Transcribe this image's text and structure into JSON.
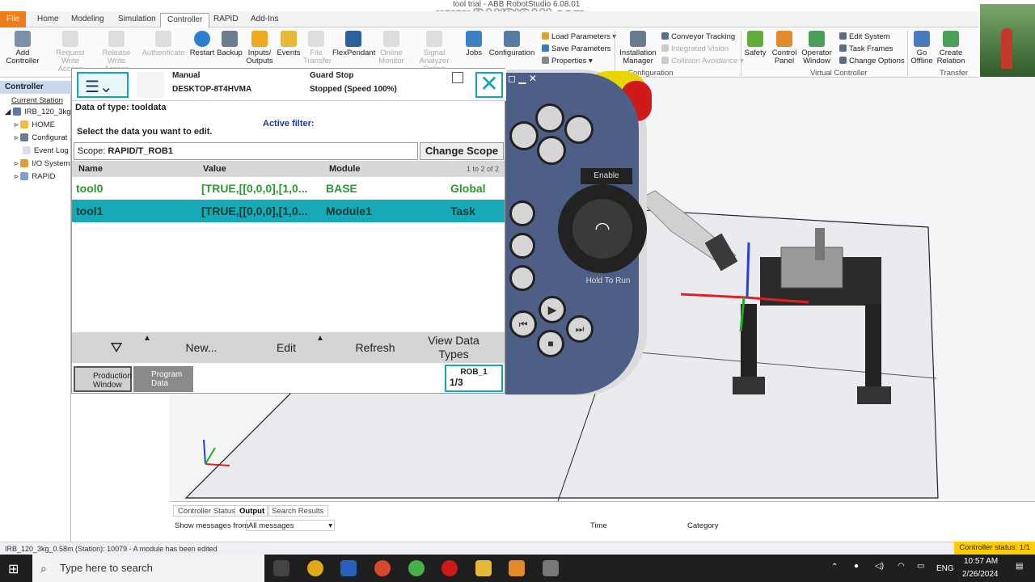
{
  "window": {
    "title": "tool trial - ABB RobotStudio 6.08.01",
    "watermark": "www.BANDICAM.com"
  },
  "tabs": [
    "File",
    "Home",
    "Modeling",
    "Simulation",
    "Controller",
    "RAPID",
    "Add-Ins"
  ],
  "ribbon": {
    "add_controller": "Add\nController",
    "request_write_access": "Request\nWrite Access",
    "release_write_access": "Release\nWrite Access",
    "authenticate": "Authenticate",
    "restart": "Restart",
    "backup": "Backup",
    "inputs_outputs": "Inputs/\nOutputs",
    "events": "Events",
    "file_transfer": "File\nTransfer",
    "flexpendant": "FlexPendant",
    "online_monitor": "Online\nMonitor",
    "signal_analyzer": "Signal Analyzer\nOnline",
    "jobs": "Jobs",
    "configuration": "Configuration",
    "load_parameters": "Load Parameters",
    "save_parameters": "Save Parameters",
    "properties": "Properties",
    "installation_manager": "Installation\nManager",
    "conveyor_tracking": "Conveyor Tracking",
    "integrated_vision": "Integrated Vision",
    "collision_avoidance": "Collision Avoidance",
    "group_configuration": "Configuration",
    "safety": "Safety",
    "control_panel": "Control\nPanel",
    "operator_window": "Operator\nWindow",
    "edit_system": "Edit System",
    "task_frames": "Task Frames",
    "change_options": "Change Options",
    "group_virtual_controller": "Virtual Controller",
    "go_offline": "Go\nOffline",
    "create_relation": "Create\nRelation",
    "group_transfer": "Transfer"
  },
  "left_panel": {
    "header": "Controller",
    "current_station": "Current Station",
    "items": [
      "IRB_120_3kg",
      "HOME",
      "Configurat",
      "Event Log",
      "I/O System",
      "RAPID"
    ]
  },
  "flexpendant": {
    "mode": "Manual",
    "system_name": "DESKTOP-8T4HVMA",
    "state": "Guard Stop",
    "speed": "Stopped (Speed 100%)",
    "data_type": "Data of type: tooldata",
    "instruction": "Select the data you want to edit.",
    "filter_label": "Active filter:",
    "scope_label": "Scope:",
    "scope_value": "RAPID/T_ROB1",
    "change_scope": "Change Scope",
    "columns": [
      "Name",
      "Value",
      "Module"
    ],
    "count": "1 to 2 of 2",
    "rows": [
      {
        "name": "tool0",
        "value": "[TRUE,[[0,0,0],[1,0...",
        "module": "BASE",
        "scope": "Global"
      },
      {
        "name": "tool1",
        "value": "[TRUE,[[0,0,0],[1,0...",
        "module": "Module1",
        "scope": "Task"
      }
    ],
    "bottom_buttons": {
      "new": "New...",
      "edit": "Edit",
      "refresh": "Refresh",
      "view": "View Data\nTypes"
    },
    "taskbar": {
      "production": "Production\nWindow",
      "program": "Program\nData",
      "rob": "ROB_1",
      "ratio": "1/3"
    }
  },
  "pendant": {
    "enable": "Enable",
    "hold_to_run": "Hold To Run"
  },
  "output": {
    "tabs": [
      "Controller Status",
      "Output",
      "Search Results"
    ],
    "show_label": "Show messages from",
    "show_value": "All messages",
    "col_time": "Time",
    "col_category": "Category"
  },
  "status": {
    "message": "IRB_120_3kg_0.58m (Station): 10079 - A module has been edited",
    "controller_status": "Controller status: 1/1"
  },
  "taskbar": {
    "search_placeholder": "Type here to search",
    "lang": "ENG",
    "time": "10:57 AM",
    "date": "2/26/2024"
  }
}
